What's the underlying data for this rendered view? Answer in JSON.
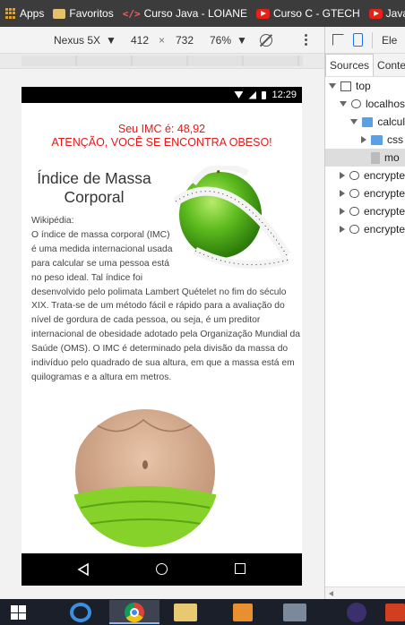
{
  "bookmarks": {
    "items": [
      {
        "label": "Apps",
        "icon": "apps-grid-icon"
      },
      {
        "label": "Favoritos",
        "icon": "folder-icon"
      },
      {
        "label": "Curso Java - LOIANE",
        "icon": "code-icon"
      },
      {
        "label": "Curso C - GTECH",
        "icon": "youtube-icon"
      },
      {
        "label": "Java",
        "icon": "youtube-icon"
      }
    ]
  },
  "device_toolbar": {
    "device": "Nexus 5X",
    "width": "412",
    "times": "×",
    "height": "732",
    "zoom": "76%",
    "caret": "▼"
  },
  "phone": {
    "status_time": "12:29",
    "result_line1": "Seu IMC é: 48,92",
    "result_line2": "ATENÇÃO, VOCÊ SE ENCONTRA OBESO!",
    "title": "Índice de Massa Corporal",
    "source_label": "Wikipédia:",
    "article": "O índice de massa corporal (IMC) é uma medida internacional usada para calcular se uma pessoa está no peso ideal. Tal índice foi desenvolvido pelo polimata Lambert Quételet no fim do século XIX. Trata-se de um método fácil e rápido para a avaliação do nível de gordura de cada pessoa, ou seja, é um preditor internacional de obesidade adotado pela Organização Mundial da Saúde (OMS). O IMC é determinado pela divisão da massa do indivíduo pelo quadrado de sua altura, em que a massa está em quilogramas e a altura em metros.",
    "colors": {
      "alert": "#e51919",
      "apple": "#5dbb1e",
      "towel": "#86d12a"
    }
  },
  "devtools": {
    "tab_elements": "Ele",
    "tabs": [
      "Sources",
      "Conte"
    ],
    "tree": [
      {
        "label": "top",
        "icon": "frame-icon",
        "expanded": true
      },
      {
        "label": "localhos",
        "icon": "cloud-icon",
        "expanded": true
      },
      {
        "label": "calcul",
        "icon": "folder-icon",
        "expanded": true
      },
      {
        "label": "css",
        "icon": "folder-icon",
        "expanded": false
      },
      {
        "label": "mo",
        "icon": "file-icon",
        "selected": true
      },
      {
        "label": "encrypte",
        "icon": "cloud-icon",
        "expanded": false
      },
      {
        "label": "encrypte",
        "icon": "cloud-icon",
        "expanded": false
      },
      {
        "label": "encrypte",
        "icon": "cloud-icon",
        "expanded": false
      },
      {
        "label": "encrypte",
        "icon": "cloud-icon",
        "expanded": false
      }
    ]
  }
}
